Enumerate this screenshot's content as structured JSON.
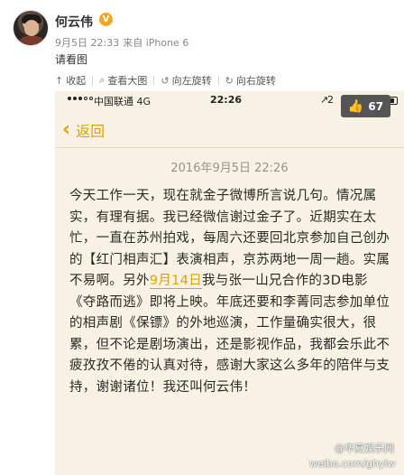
{
  "post": {
    "user_name": "何云伟",
    "vip_badge": "V",
    "date": "9月5日 22:33",
    "source": "来自 iPhone 6",
    "text": "请看图"
  },
  "actions": [
    {
      "icon": "collapse-icon",
      "glyph": "↑",
      "label": "收起"
    },
    {
      "icon": "search-icon",
      "glyph": "⌕",
      "label": "查看大图"
    },
    {
      "icon": "rotate-left-icon",
      "glyph": "↺",
      "label": "向左旋转"
    },
    {
      "icon": "rotate-right-icon",
      "glyph": "↻",
      "label": "向右旋转"
    }
  ],
  "screenshot": {
    "status_bar": {
      "carrier": "中国联通",
      "network": "4G",
      "time": "22:26",
      "location_arrow": "↗",
      "lock_prefix": "2"
    },
    "like_count": "67",
    "back_label": "返回",
    "note_date": "2016年9月5日 22:26",
    "body_before_link": "今天工作一天，现在就金子微博所言说几句。情况属实，有理有据。我已经微信谢过金子了。近期实在太忙，一直在苏州拍戏，每周六还要回北京参加自己创办的【红门相声汇】表演相声，京苏两地一周一趟。实属不易啊。另外",
    "body_link": "9月14日",
    "body_after_link": "我与张一山兄合作的3D电影《夺路而逃》即将上映。年底还要和李菁同志参加单位的相声剧《保镖》的外地巡演，工作量确实很大，很累，但不论是剧场演出，还是影视作品，我都会乐此不疲孜孜不倦的认真对待，感谢大家这么多年的陪伴与支持，谢谢诸位！我还叫何云伟！",
    "watermark_line1": "@华夏娱乐网",
    "watermark_line2": "weibo.com/ghylw"
  },
  "colors": {
    "accent": "#e0a10a",
    "note_background": "#f7f2e4",
    "badge": "#f5a623"
  }
}
